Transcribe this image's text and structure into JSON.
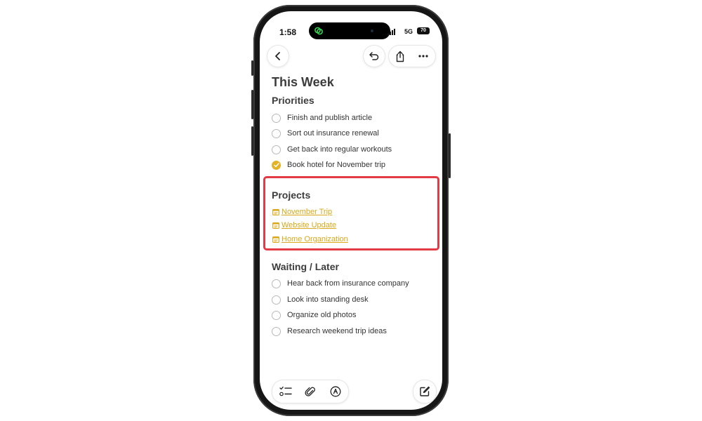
{
  "status_bar": {
    "time": "1:58",
    "network": "5G",
    "battery": "70"
  },
  "note": {
    "title": "This Week",
    "priorities": {
      "heading": "Priorities",
      "items": [
        {
          "text": "Finish and publish article",
          "checked": false
        },
        {
          "text": "Sort out insurance renewal",
          "checked": false
        },
        {
          "text": "Get back into regular workouts",
          "checked": false
        },
        {
          "text": "Book hotel for November trip",
          "checked": true
        }
      ]
    },
    "projects": {
      "heading": "Projects",
      "links": [
        {
          "text": "November Trip"
        },
        {
          "text": "Website Update"
        },
        {
          "text": "Home Organization"
        }
      ]
    },
    "waiting": {
      "heading": "Waiting / Later",
      "items": [
        {
          "text": "Hear back from insurance company",
          "checked": false
        },
        {
          "text": "Look into standing desk",
          "checked": false
        },
        {
          "text": "Organize old photos",
          "checked": false
        },
        {
          "text": "Research weekend trip ideas",
          "checked": false
        }
      ]
    }
  },
  "icons": {
    "back": "chevron-left-icon",
    "undo": "undo-icon",
    "share": "share-icon",
    "more": "more-icon",
    "checklist": "checklist-icon",
    "attach": "paperclip-icon",
    "markup": "markup-pen-icon",
    "compose": "compose-icon",
    "note_link": "note-link-icon"
  },
  "colors": {
    "accent": "#e3b226",
    "link": "#d9a81c",
    "highlight": "#e33b46"
  }
}
